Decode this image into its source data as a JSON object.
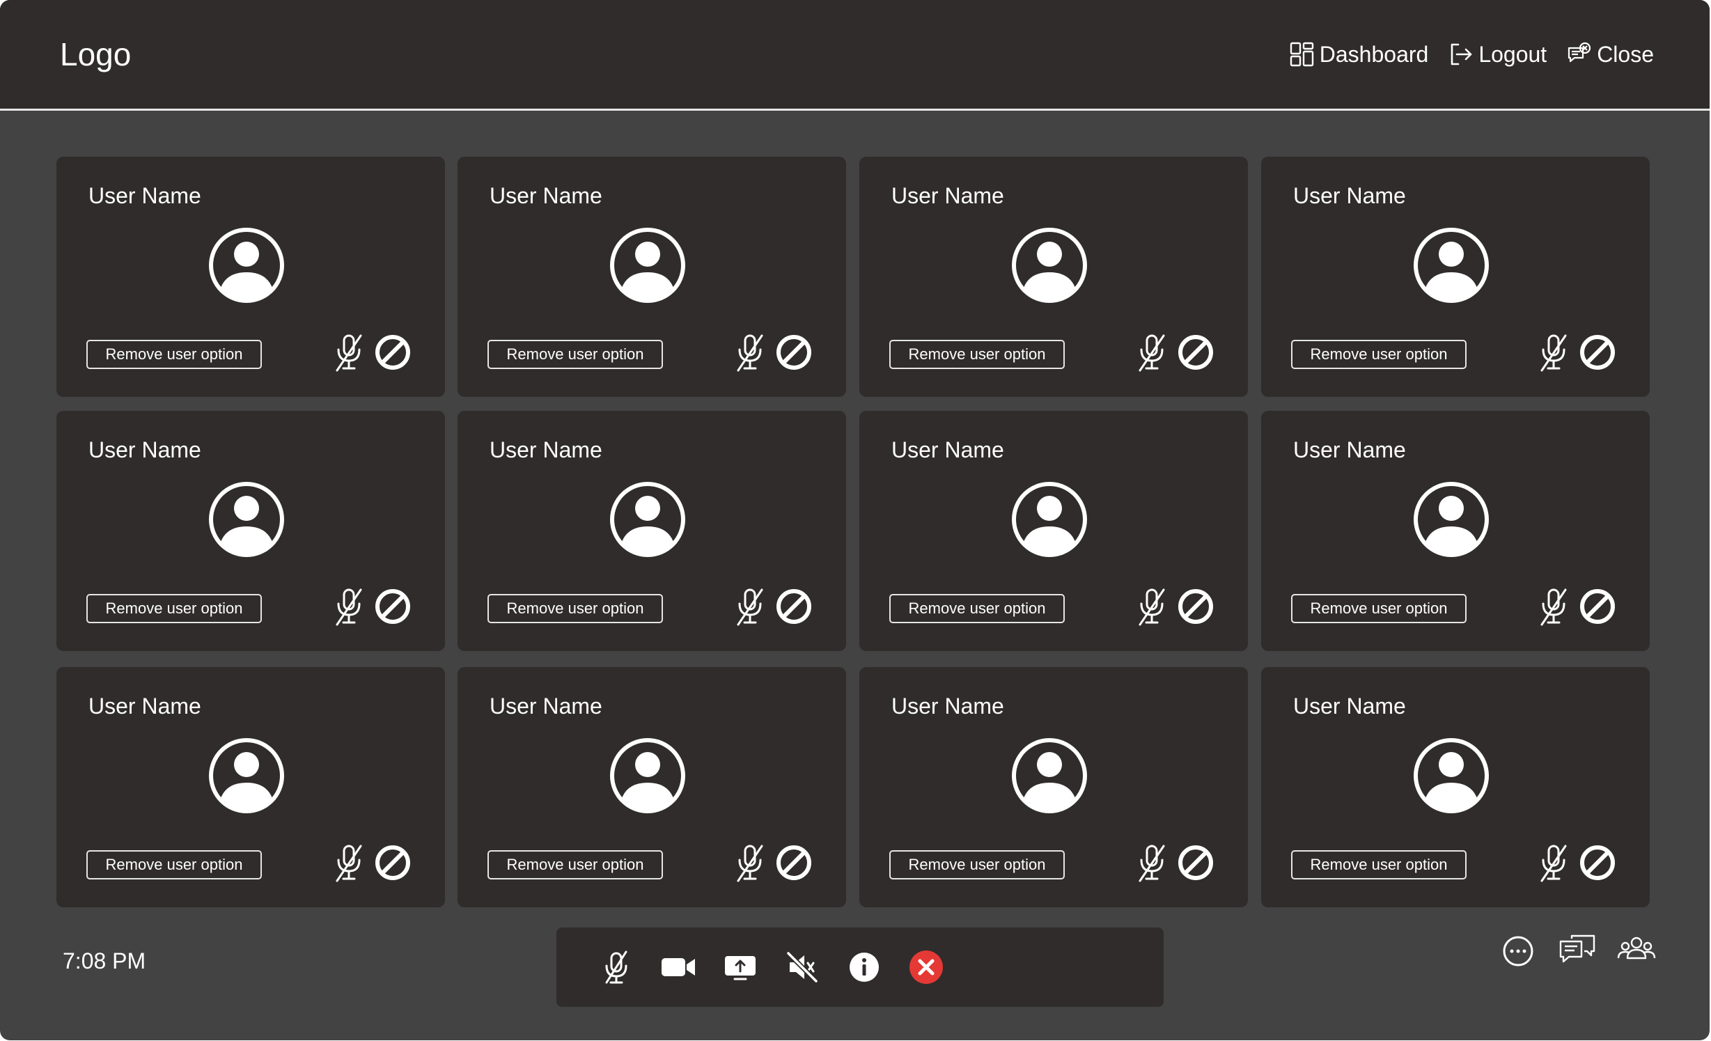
{
  "header": {
    "logo": "Logo",
    "nav": [
      {
        "label": "Dashboard",
        "icon": "dashboard-grid-icon"
      },
      {
        "label": "Logout",
        "icon": "logout-icon"
      },
      {
        "label": "Close",
        "icon": "close-chat-icon"
      }
    ]
  },
  "participants": [
    {
      "name": "User Name",
      "remove_label": "Remove user option",
      "mic": "mic-muted-icon",
      "block": "block-icon"
    },
    {
      "name": "User Name",
      "remove_label": "Remove user option",
      "mic": "mic-muted-icon",
      "block": "block-icon"
    },
    {
      "name": "User Name",
      "remove_label": "Remove user option",
      "mic": "mic-muted-icon",
      "block": "block-icon"
    },
    {
      "name": "User Name",
      "remove_label": "Remove user option",
      "mic": "mic-muted-icon",
      "block": "block-icon"
    },
    {
      "name": "User Name",
      "remove_label": "Remove user option",
      "mic": "mic-muted-icon",
      "block": "block-icon"
    },
    {
      "name": "User Name",
      "remove_label": "Remove user option",
      "mic": "mic-muted-icon",
      "block": "block-icon"
    },
    {
      "name": "User Name",
      "remove_label": "Remove user option",
      "mic": "mic-muted-icon",
      "block": "block-icon"
    },
    {
      "name": "User Name",
      "remove_label": "Remove user option",
      "mic": "mic-muted-icon",
      "block": "block-icon"
    },
    {
      "name": "User Name",
      "remove_label": "Remove user option",
      "mic": "mic-muted-icon",
      "block": "block-icon"
    },
    {
      "name": "User Name",
      "remove_label": "Remove user option",
      "mic": "mic-muted-icon",
      "block": "block-icon"
    },
    {
      "name": "User Name",
      "remove_label": "Remove user option",
      "mic": "mic-muted-icon",
      "block": "block-icon"
    },
    {
      "name": "User Name",
      "remove_label": "Remove user option",
      "mic": "mic-muted-icon",
      "block": "block-icon"
    }
  ],
  "footer": {
    "time": "7:08 PM",
    "controls": [
      "mic-muted-icon",
      "video-camera-icon",
      "share-screen-icon",
      "speaker-muted-icon",
      "info-icon",
      "end-call-icon"
    ],
    "side_icons": [
      "more-options-icon",
      "chat-icon",
      "participants-icon"
    ]
  },
  "colors": {
    "background": "#434343",
    "panel": "#302c2c",
    "text": "#ffffff",
    "end_call": "#e53935"
  }
}
